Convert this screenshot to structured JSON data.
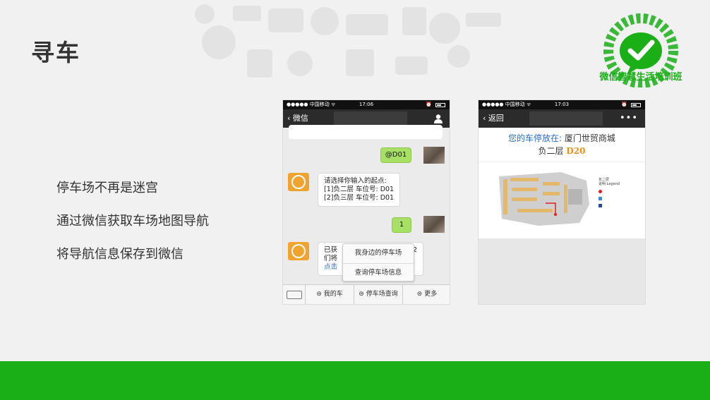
{
  "slide": {
    "title": "寻车",
    "logo_text": "微信智慧生活培训班",
    "bullets": [
      "停车场不再是迷宫",
      "通过微信获取车场地图导航",
      "将导航信息保存到微信"
    ],
    "colors": {
      "brand_green": "#1aaf17",
      "title_text": "#333333"
    }
  },
  "phone1": {
    "status": {
      "carrier": "●●●●● 中国移动 ᯤ",
      "time": "17:06"
    },
    "nav": {
      "back_label": "微信",
      "right_icon": "person-icon"
    },
    "chat": {
      "top_bubble_partial": "…",
      "msg_d01": "@D01",
      "reply_lines": [
        "请选择你输入的起点:",
        "[1]负二层 车位号: D01",
        "[2]负三层 车位号: D01"
      ],
      "msg_1": "1",
      "partial_lines": [
        "已获",
        "们将",
        "点击"
      ],
      "partial_suffix": "2"
    },
    "popup": [
      "我身边的停车场",
      "查询停车场信息"
    ],
    "tabs": [
      "我的车",
      "停车场查询",
      "更多"
    ]
  },
  "phone2": {
    "status": {
      "carrier": "●●●●● 中国移动 ᯤ",
      "time": "17:03"
    },
    "nav": {
      "back_label": "返回",
      "more_label": "•••"
    },
    "parking": {
      "label": "您的车停放在:",
      "location": "厦门世贸商城",
      "floor": "负二层",
      "spot": "D20"
    },
    "legend": {
      "title1": "负二层",
      "title2": "说明:Legend"
    }
  }
}
